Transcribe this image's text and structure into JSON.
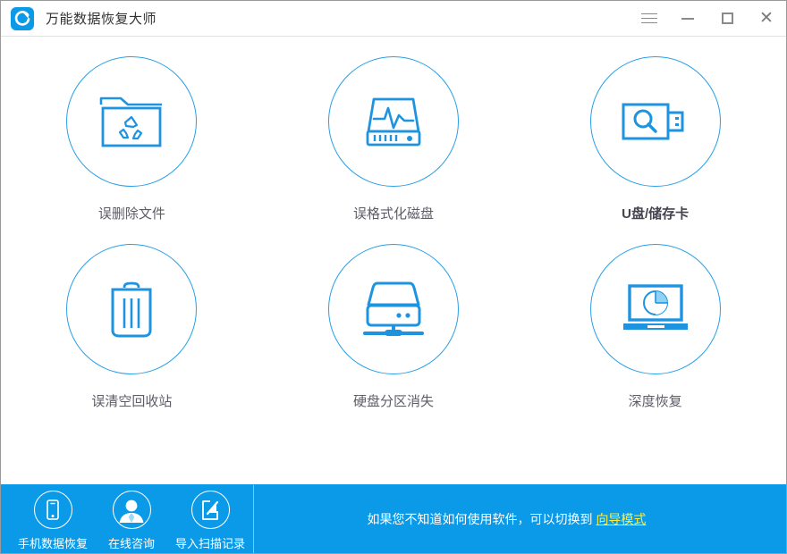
{
  "window": {
    "title": "万能数据恢复大师",
    "logo_icon": "refresh-circle-logo-icon",
    "controls": {
      "menu": {
        "icon": "hamburger-menu-icon",
        "label": ""
      },
      "minimize": {
        "icon": "minimize-icon",
        "label": ""
      },
      "maximize": {
        "icon": "maximize-icon",
        "label": ""
      },
      "close": {
        "icon": "close-icon",
        "label": "✕"
      }
    }
  },
  "colors": {
    "brand_blue": "#0b9ae8",
    "icon_blue": "#27a0e8",
    "label_gray": "#5d5d68",
    "link_yellow": "#ffec3d",
    "window_border": "#9a9a9a"
  },
  "main": {
    "tiles": [
      {
        "label": "误删除文件",
        "icon": "folder-recycle-icon",
        "emphasis": false
      },
      {
        "label": "误格式化磁盘",
        "icon": "disk-waveform-icon",
        "emphasis": false
      },
      {
        "label": "U盘/储存卡",
        "icon": "usb-drive-search-icon",
        "emphasis": true
      },
      {
        "label": "误清空回收站",
        "icon": "trash-can-icon",
        "emphasis": false
      },
      {
        "label": "硬盘分区消失",
        "icon": "external-hard-drive-icon",
        "emphasis": false
      },
      {
        "label": "深度恢复",
        "icon": "laptop-scan-pie-icon",
        "emphasis": false
      }
    ]
  },
  "bottombar": {
    "quick_actions": [
      {
        "label": "手机数据恢复",
        "icon": "mobile-phone-icon"
      },
      {
        "label": "在线咨询",
        "icon": "user-avatar-icon"
      },
      {
        "label": "导入扫描记录",
        "icon": "import-arrow-box-icon"
      }
    ],
    "hint_text": "如果您不知道如何使用软件，可以切换到 ",
    "hint_link": "向导模式"
  }
}
